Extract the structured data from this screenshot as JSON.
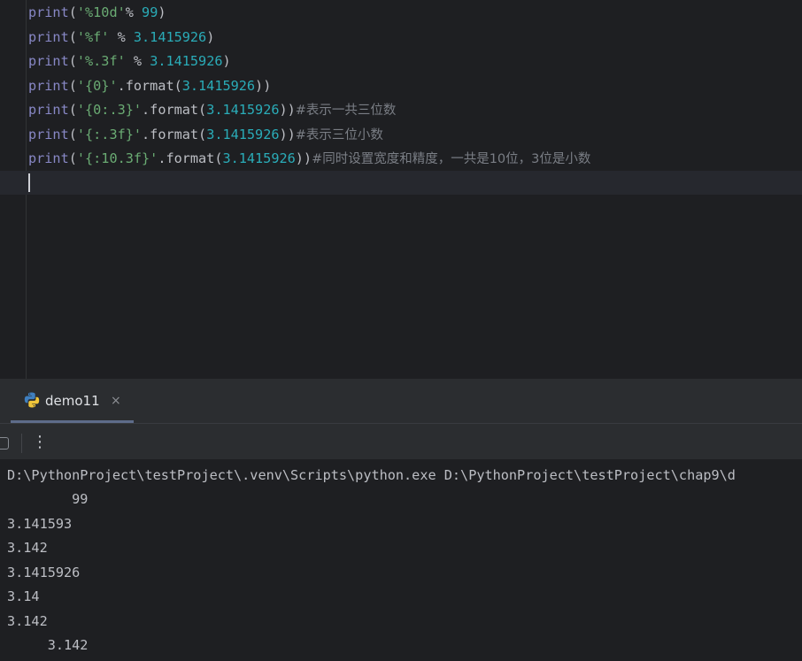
{
  "editor": {
    "lines": [
      {
        "fn": "print",
        "p1": "(",
        "str": "'%10d'",
        "mid": "% ",
        "num": "99",
        "p2": ")",
        "comment": ""
      },
      {
        "fn": "print",
        "p1": "(",
        "str": "'%f'",
        "mid": " % ",
        "num": "3.1415926",
        "p2": ")",
        "comment": ""
      },
      {
        "fn": "print",
        "p1": "(",
        "str": "'%.3f'",
        "mid": " % ",
        "num": "3.1415926",
        "p2": ")",
        "comment": ""
      },
      {
        "fn": "print",
        "p1": "(",
        "str": "'{0}'",
        "mid": ".format(",
        "num": "3.1415926",
        "p2": "))",
        "comment": ""
      },
      {
        "fn": "print",
        "p1": "(",
        "str": "'{0:.3}'",
        "mid": ".format(",
        "num": "3.1415926",
        "p2": "))",
        "comment": "#表示一共三位数"
      },
      {
        "fn": "print",
        "p1": "(",
        "str": "'{:.3f}'",
        "mid": ".format(",
        "num": "3.1415926",
        "p2": "))",
        "comment": "#表示三位小数"
      },
      {
        "fn": "print",
        "p1": "(",
        "str": "'{:10.3f}'",
        "mid": ".format(",
        "num": "3.1415926",
        "p2": "))",
        "comment": "#同时设置宽度和精度，一共是10位，3位是小数"
      }
    ]
  },
  "run_panel": {
    "tab_label": "demo11",
    "tab_close": "×",
    "more_label": "⋮",
    "icons": {
      "python": "python-icon",
      "stop": "stop-icon",
      "more": "more-vertical-icon",
      "close": "close-icon"
    },
    "output": [
      "D:\\PythonProject\\testProject\\.venv\\Scripts\\python.exe D:\\PythonProject\\testProject\\chap9\\d",
      "        99",
      "3.141593",
      "3.142",
      "3.1415926",
      "3.14",
      "3.142",
      "     3.142"
    ]
  },
  "colors": {
    "background": "#1e1f22",
    "panel": "#2b2d30",
    "function": "#56a8f5",
    "string": "#6aab73",
    "number": "#2aacb8",
    "comment": "#7a7e85",
    "text": "#bcbec4"
  }
}
